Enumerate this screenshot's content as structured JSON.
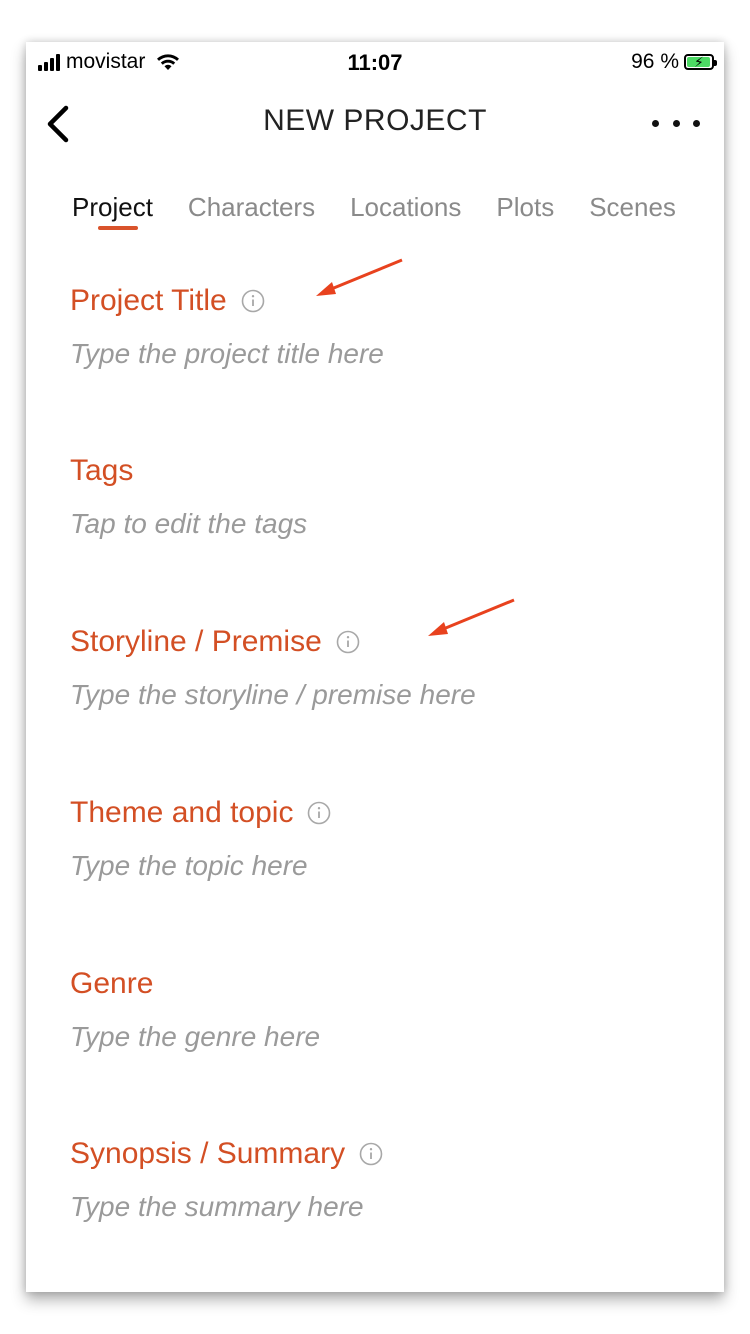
{
  "status_bar": {
    "carrier": "movistar",
    "time": "11:07",
    "battery_text": "96 %",
    "battery_level": 0.96
  },
  "nav": {
    "title": "NEW PROJECT"
  },
  "tabs": [
    {
      "label": "Project",
      "active": true
    },
    {
      "label": "Characters",
      "active": false
    },
    {
      "label": "Locations",
      "active": false
    },
    {
      "label": "Plots",
      "active": false
    },
    {
      "label": "Scenes",
      "active": false
    }
  ],
  "fields": [
    {
      "label": "Project Title",
      "placeholder": "Type the project title here",
      "has_info": true
    },
    {
      "label": "Tags",
      "placeholder": "Tap to edit the tags",
      "has_info": false
    },
    {
      "label": "Storyline / Premise",
      "placeholder": "Type the storyline / premise here",
      "has_info": true
    },
    {
      "label": "Theme and topic",
      "placeholder": "Type the topic here",
      "has_info": true
    },
    {
      "label": "Genre",
      "placeholder": "Type the genre here",
      "has_info": false
    },
    {
      "label": "Synopsis / Summary",
      "placeholder": "Type the summary here",
      "has_info": true
    }
  ],
  "colors": {
    "accent": "#d34f24",
    "annotation_arrow": "#e8421e",
    "placeholder": "#9a9a9a",
    "battery_fill": "#4cd964"
  },
  "icons": {
    "back": "chevron-left-icon",
    "more": "more-horizontal-icon",
    "info": "info-circle-icon",
    "wifi": "wifi-icon",
    "signal": "signal-bars-icon",
    "battery": "battery-charging-icon"
  }
}
